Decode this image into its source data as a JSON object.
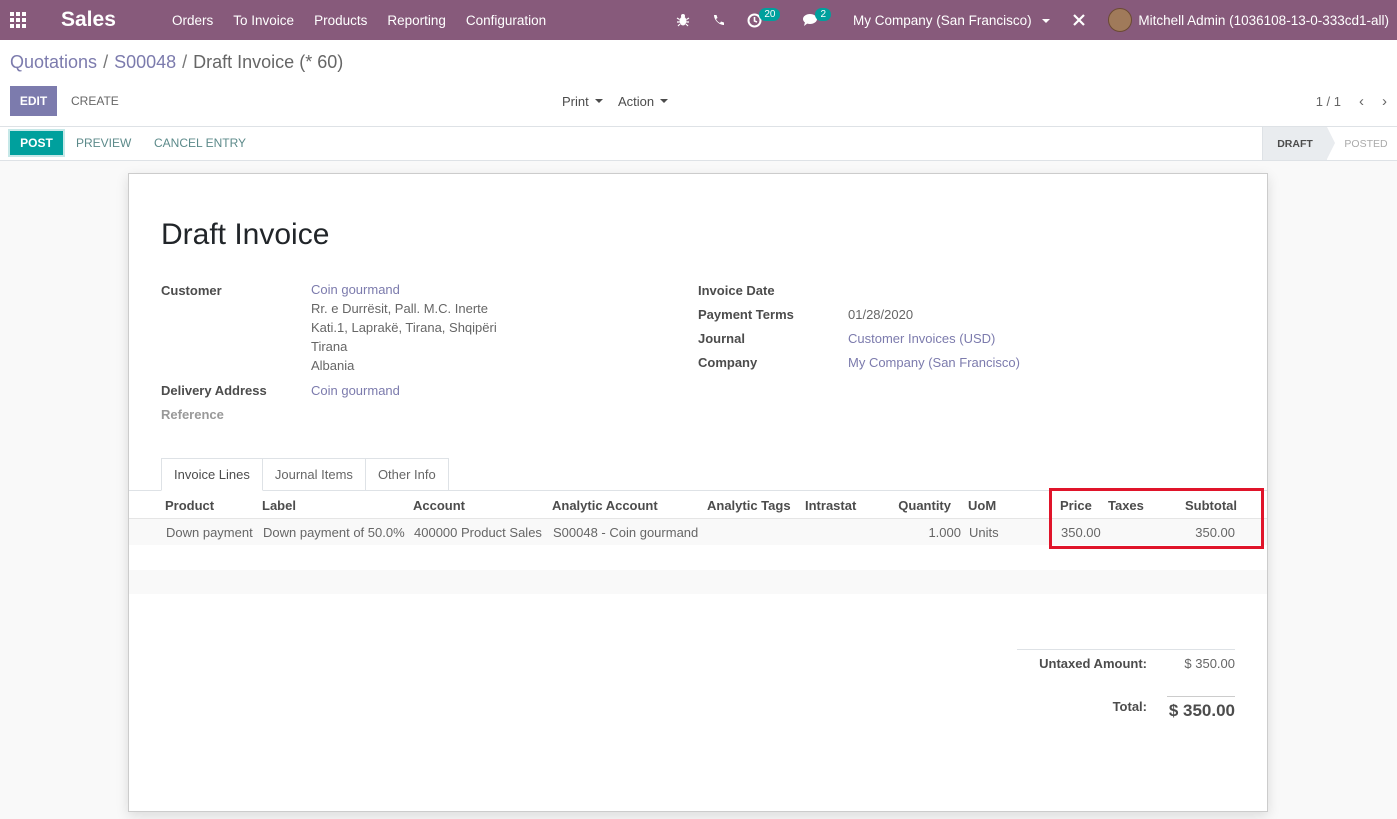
{
  "navbar": {
    "app_name": "Sales",
    "menu": [
      "Orders",
      "To Invoice",
      "Products",
      "Reporting",
      "Configuration"
    ],
    "activity_count": "20",
    "message_count": "2",
    "company": "My Company (San Francisco)",
    "user": "Mitchell Admin (1036108-13-0-333cd1-all)",
    "accent": "#875a7b"
  },
  "breadcrumb": {
    "item1": "Quotations",
    "sep": "/",
    "item2": "S00048",
    "current": "Draft Invoice (* 60)"
  },
  "buttons": {
    "edit": "EDIT",
    "create": "CREATE",
    "print": "Print",
    "action": "Action",
    "post": "POST",
    "preview": "PREVIEW",
    "cancel_entry": "CANCEL ENTRY"
  },
  "pager": "1 / 1",
  "stages": {
    "draft": "DRAFT",
    "posted": "POSTED"
  },
  "invoice": {
    "title": "Draft Invoice",
    "labels": {
      "customer": "Customer",
      "delivery_address": "Delivery Address",
      "reference": "Reference",
      "invoice_date": "Invoice Date",
      "payment_terms": "Payment Terms",
      "journal": "Journal",
      "company": "Company"
    },
    "customer_name": "Coin gourmand",
    "address_lines": [
      "Rr. e Durrësit, Pall. M.C. Inerte",
      "Kati.1, Laprakë, Tirana, Shqipëri",
      "Tirana",
      "Albania"
    ],
    "delivery_address": "Coin gourmand",
    "payment_terms": "01/28/2020",
    "journal": "Customer Invoices (USD)",
    "company": "My Company (San Francisco)"
  },
  "tabs": [
    "Invoice Lines",
    "Journal Items",
    "Other Info"
  ],
  "table": {
    "columns": [
      "Product",
      "Label",
      "Account",
      "Analytic Account",
      "Analytic Tags",
      "Intrastat",
      "Quantity",
      "UoM",
      "Price",
      "Taxes",
      "Subtotal"
    ],
    "row": {
      "product": "Down payment",
      "label": "Down payment of 50.0%",
      "account": "400000 Product Sales",
      "analytic_account": "S00048 - Coin gourmand",
      "quantity": "1.000",
      "uom": "Units",
      "price": "350.00",
      "subtotal": "350.00"
    }
  },
  "totals": {
    "untaxed_label": "Untaxed Amount:",
    "untaxed_value": "$ 350.00",
    "total_label": "Total:",
    "total_value": "$ 350.00"
  }
}
